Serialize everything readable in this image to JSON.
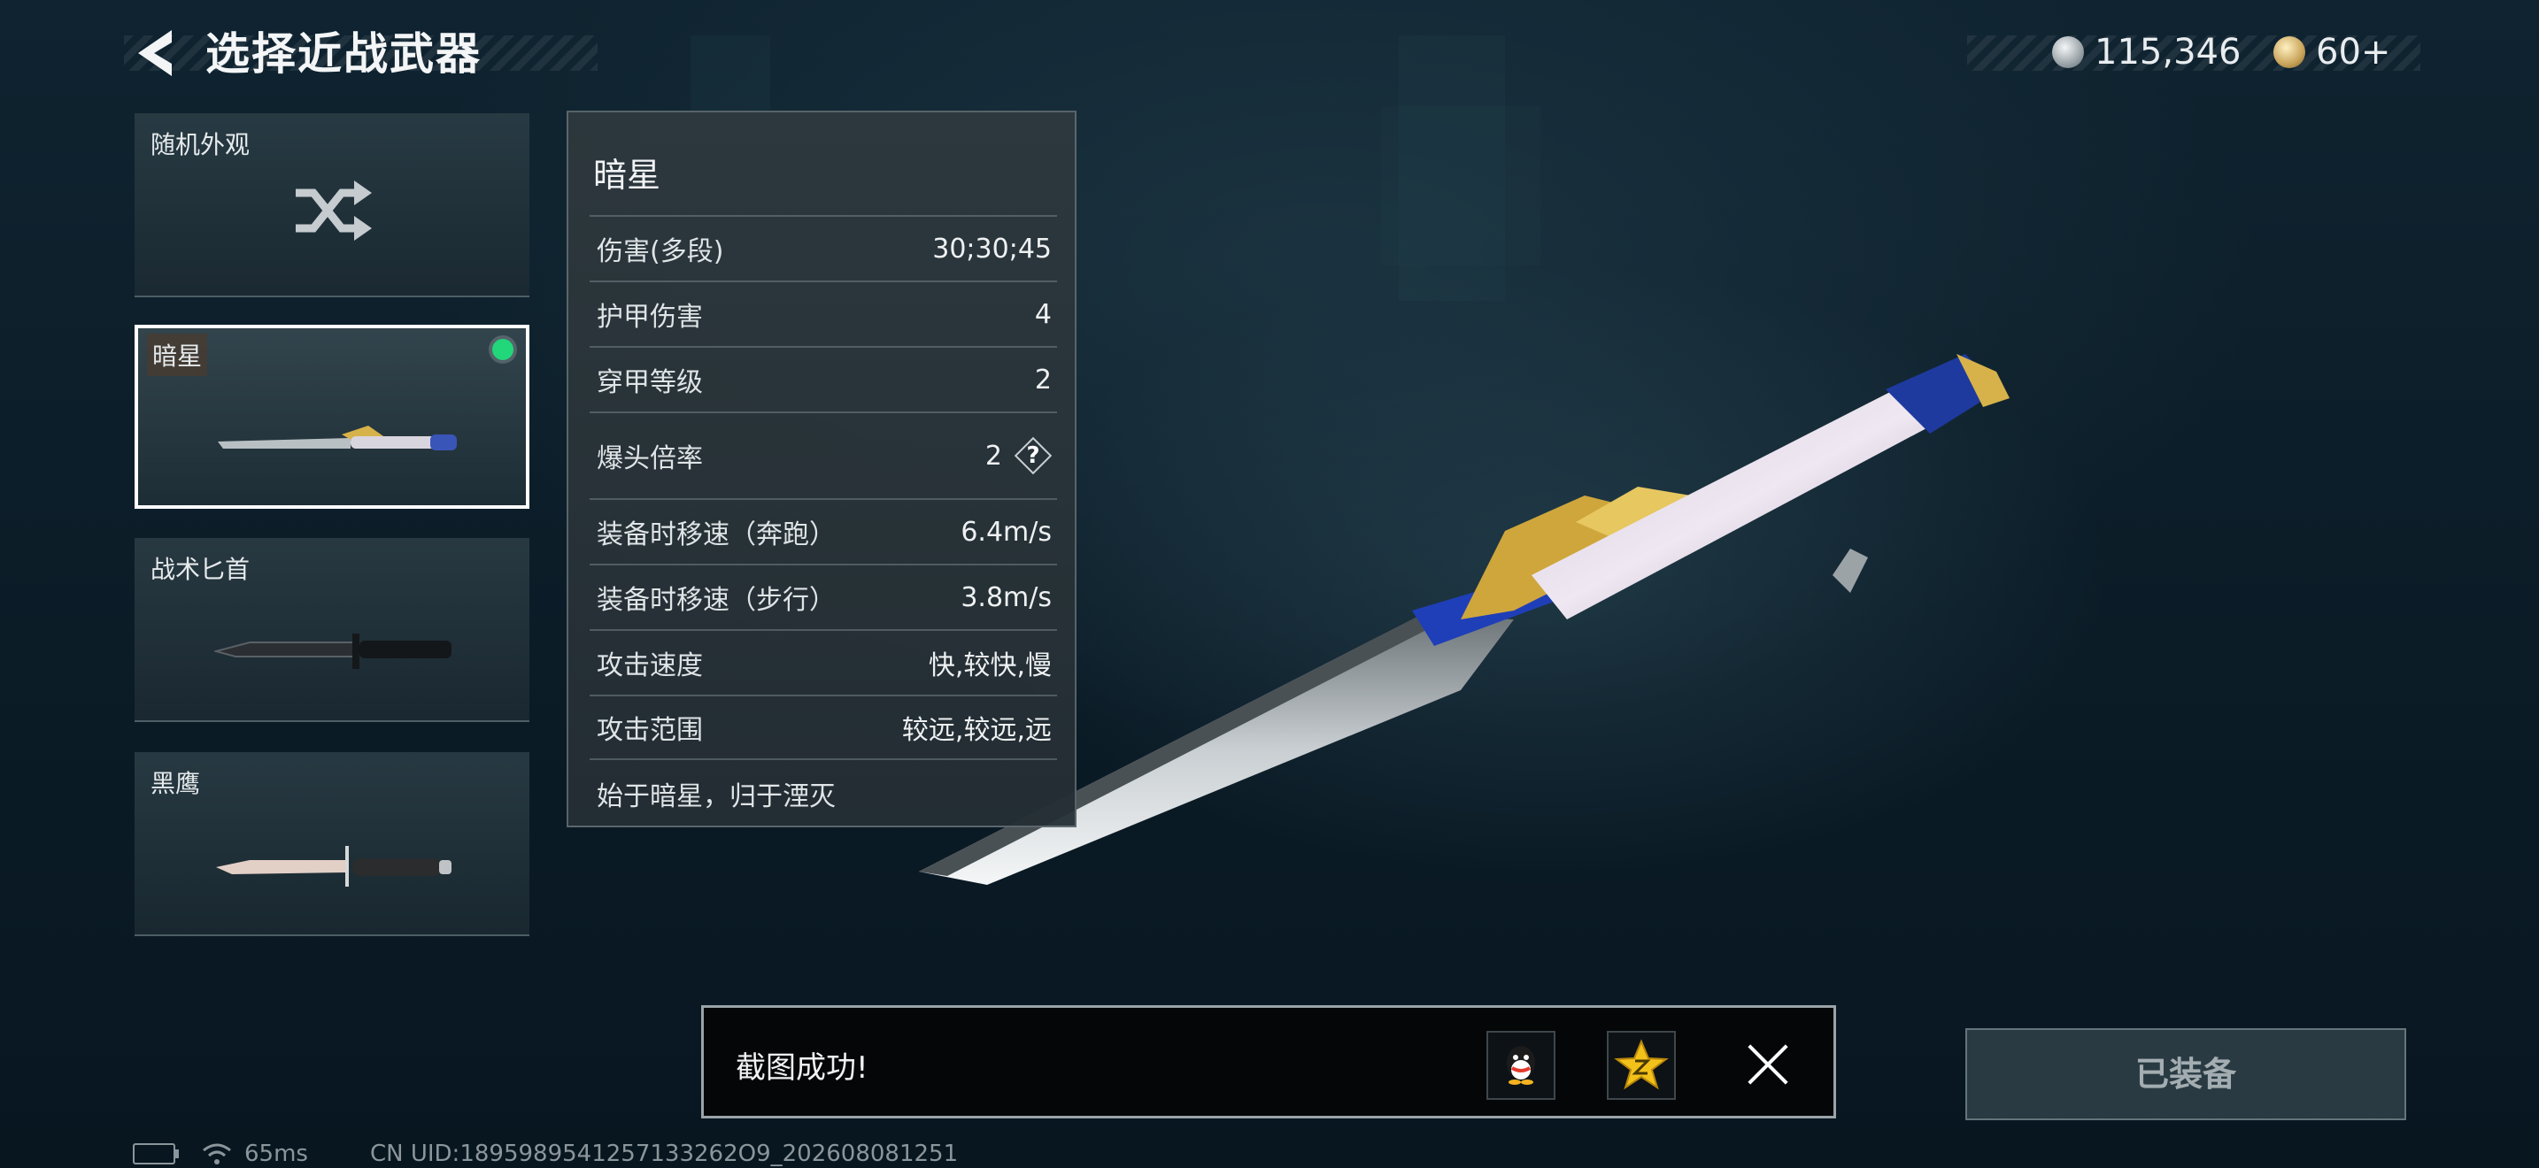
{
  "header": {
    "title": "选择近战武器"
  },
  "currency": [
    {
      "icon": "silver-coin-icon",
      "value": "115,346"
    },
    {
      "icon": "gold-coin-icon",
      "value": "60+"
    }
  ],
  "weapons": [
    {
      "label": "随机外观",
      "icon": "shuffle-icon"
    },
    {
      "label": "暗星",
      "selected": true,
      "equipped": true
    },
    {
      "label": "战术匕首"
    },
    {
      "label": "黑鹰"
    }
  ],
  "stats_panel": {
    "title": "暗星",
    "rows": [
      {
        "label": "伤害(多段)",
        "value": "30;30;45"
      },
      {
        "label": "护甲伤害",
        "value": "4"
      },
      {
        "label": "穿甲等级",
        "value": "2"
      },
      {
        "label": "爆头倍率",
        "value": "2",
        "help": "?"
      },
      {
        "label": "装备时移速（奔跑）",
        "value": "6.4m/s"
      },
      {
        "label": "装备时移速（步行）",
        "value": "3.8m/s"
      },
      {
        "label": "攻击速度",
        "value": "快,较快,慢"
      },
      {
        "label": "攻击范围",
        "value": "较远,较远,远"
      }
    ],
    "flavor": "始于暗星，归于湮灭"
  },
  "toast": {
    "message": "截图成功!",
    "share_icons": [
      "qq-icon",
      "qzone-icon"
    ]
  },
  "equip_button": {
    "label": "已装备"
  },
  "status_bar": {
    "ping": "65ms",
    "uid": "CN UID:1895989541257133262O9_202608081251"
  },
  "colors": {
    "equipped": "#22d67a",
    "background": "#0b1c27"
  }
}
